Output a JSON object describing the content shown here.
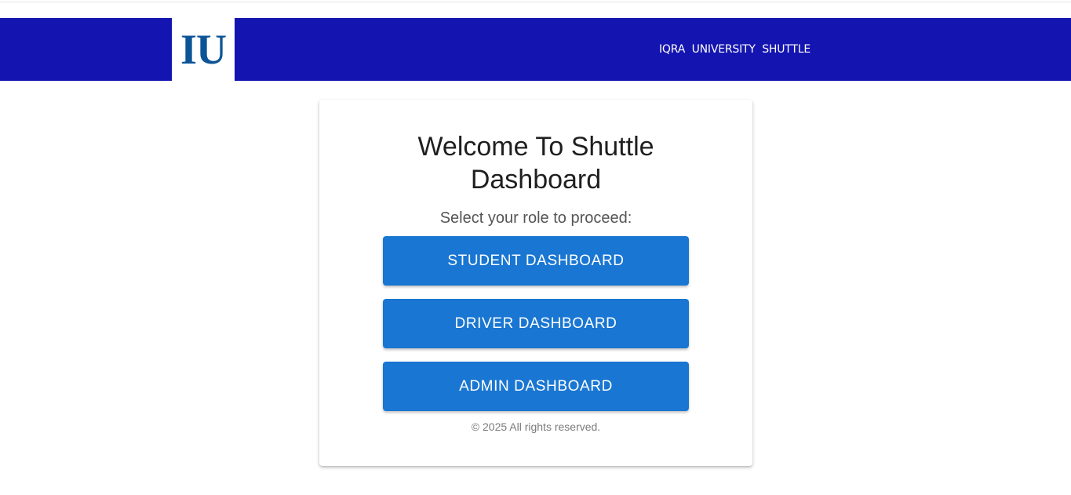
{
  "header": {
    "logo_text": "IU",
    "title": "IQRA  UNIVERSITY  SHUTTLE",
    "background_color": "#1414b0"
  },
  "card": {
    "title_line1": "Welcome To Shuttle",
    "title_line2": "Dashboard",
    "subtitle": "Select your role to proceed:",
    "buttons": [
      {
        "label": "STUDENT DASHBOARD"
      },
      {
        "label": "DRIVER DASHBOARD"
      },
      {
        "label": "ADMIN DASHBOARD"
      }
    ],
    "button_color": "#1976d2",
    "footer": "© 2025 All rights reserved."
  }
}
